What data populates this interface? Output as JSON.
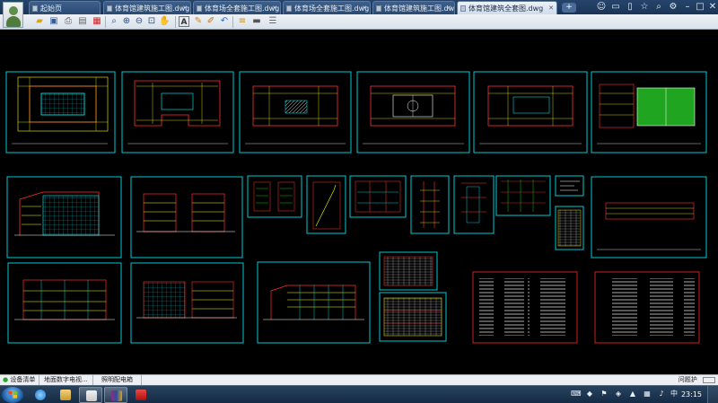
{
  "app": {
    "tabs": [
      {
        "label": "起始页",
        "active": false
      },
      {
        "label": "体育馆建筑施工图.dwg",
        "active": false
      },
      {
        "label": "体育场全套施工图.dwg",
        "active": false
      },
      {
        "label": "体育场全套施工图.dwg",
        "active": false
      },
      {
        "label": "体育馆建筑施工图.dwg",
        "active": false
      },
      {
        "label": "体育馆建筑全套图.dwg",
        "active": true
      }
    ],
    "new_tab_label": "+"
  },
  "toolbar": {
    "icons": [
      "folder-open-icon",
      "save-icon",
      "print-icon",
      "print-preview-icon",
      "pdf-icon",
      "search-icon",
      "zoom-in-icon",
      "zoom-out-icon",
      "zoom-window-icon",
      "pan-icon",
      "text-icon",
      "pencil-icon",
      "highlighter-icon",
      "undo-icon",
      "redo-icon",
      "layer-icon",
      "measure-icon",
      "layers-stack-icon"
    ]
  },
  "drawing": {
    "background": "#000000",
    "sheet_frame_color": "#00c8d2",
    "line_colors": [
      "#00ffff",
      "#ffff00",
      "#ff3030",
      "#00ff00",
      "#ffffff",
      "#ff00ff"
    ],
    "field_color": "#1fa51f",
    "notes_frame_color": "#d01f1f"
  },
  "statusbar": {
    "items": [
      "设备清单",
      "地面数字电视...",
      "照明配电箱"
    ],
    "right_text": "问题护"
  },
  "taskbar": {
    "clock": "23:15",
    "apps": [
      "ie-icon",
      "explorer-icon",
      "user-icon",
      "winrar-icon",
      "media-icon",
      "cad-viewer-icon"
    ]
  }
}
